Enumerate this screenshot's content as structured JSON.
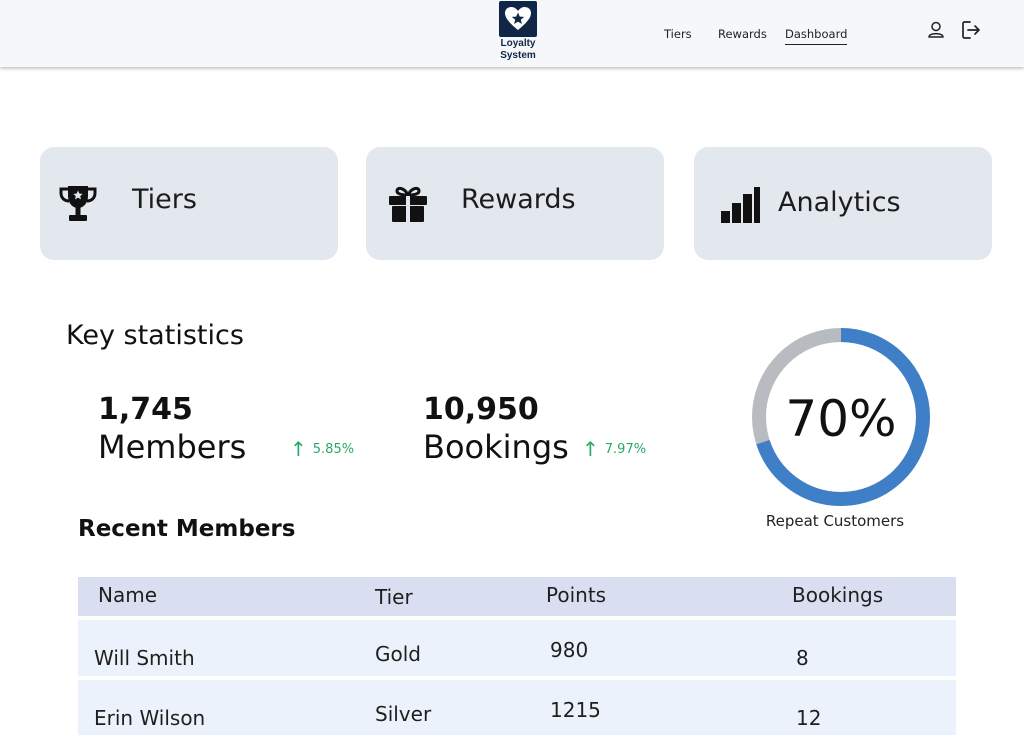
{
  "header": {
    "logo_line1": "Loyalty",
    "logo_line2": "System",
    "nav": [
      {
        "label": "Tiers"
      },
      {
        "label": "Rewards"
      },
      {
        "label": "Dashboard",
        "active": true
      }
    ],
    "icons": [
      "user-icon",
      "logout-icon"
    ]
  },
  "cards": [
    {
      "label": "Tiers",
      "icon": "trophy-icon"
    },
    {
      "label": "Rewards",
      "icon": "gift-icon"
    },
    {
      "label": "Analytics",
      "icon": "bar-chart-icon"
    }
  ],
  "stats": {
    "title": "Key statistics",
    "members": {
      "value": "1,745",
      "label": "Members",
      "trend": "5.85%"
    },
    "bookings": {
      "value": "10,950",
      "label": "Bookings",
      "trend": "7.97%"
    },
    "repeat": {
      "percent_label": "70%",
      "fraction": 0.7,
      "caption": "Repeat Customers"
    }
  },
  "colors": {
    "accent": "#3f7fc7",
    "ring_track": "#b8bcc0",
    "trend_up": "#2aa866",
    "logo": "#0f2647"
  },
  "recent": {
    "title": "Recent Members",
    "columns": [
      "Name",
      "Tier",
      "Points",
      "Bookings"
    ],
    "rows": [
      {
        "name": "Will Smith",
        "tier": "Gold",
        "points": "980",
        "bookings": "8"
      },
      {
        "name": "Erin Wilson",
        "tier": "Silver",
        "points": "1215",
        "bookings": "12"
      }
    ]
  }
}
